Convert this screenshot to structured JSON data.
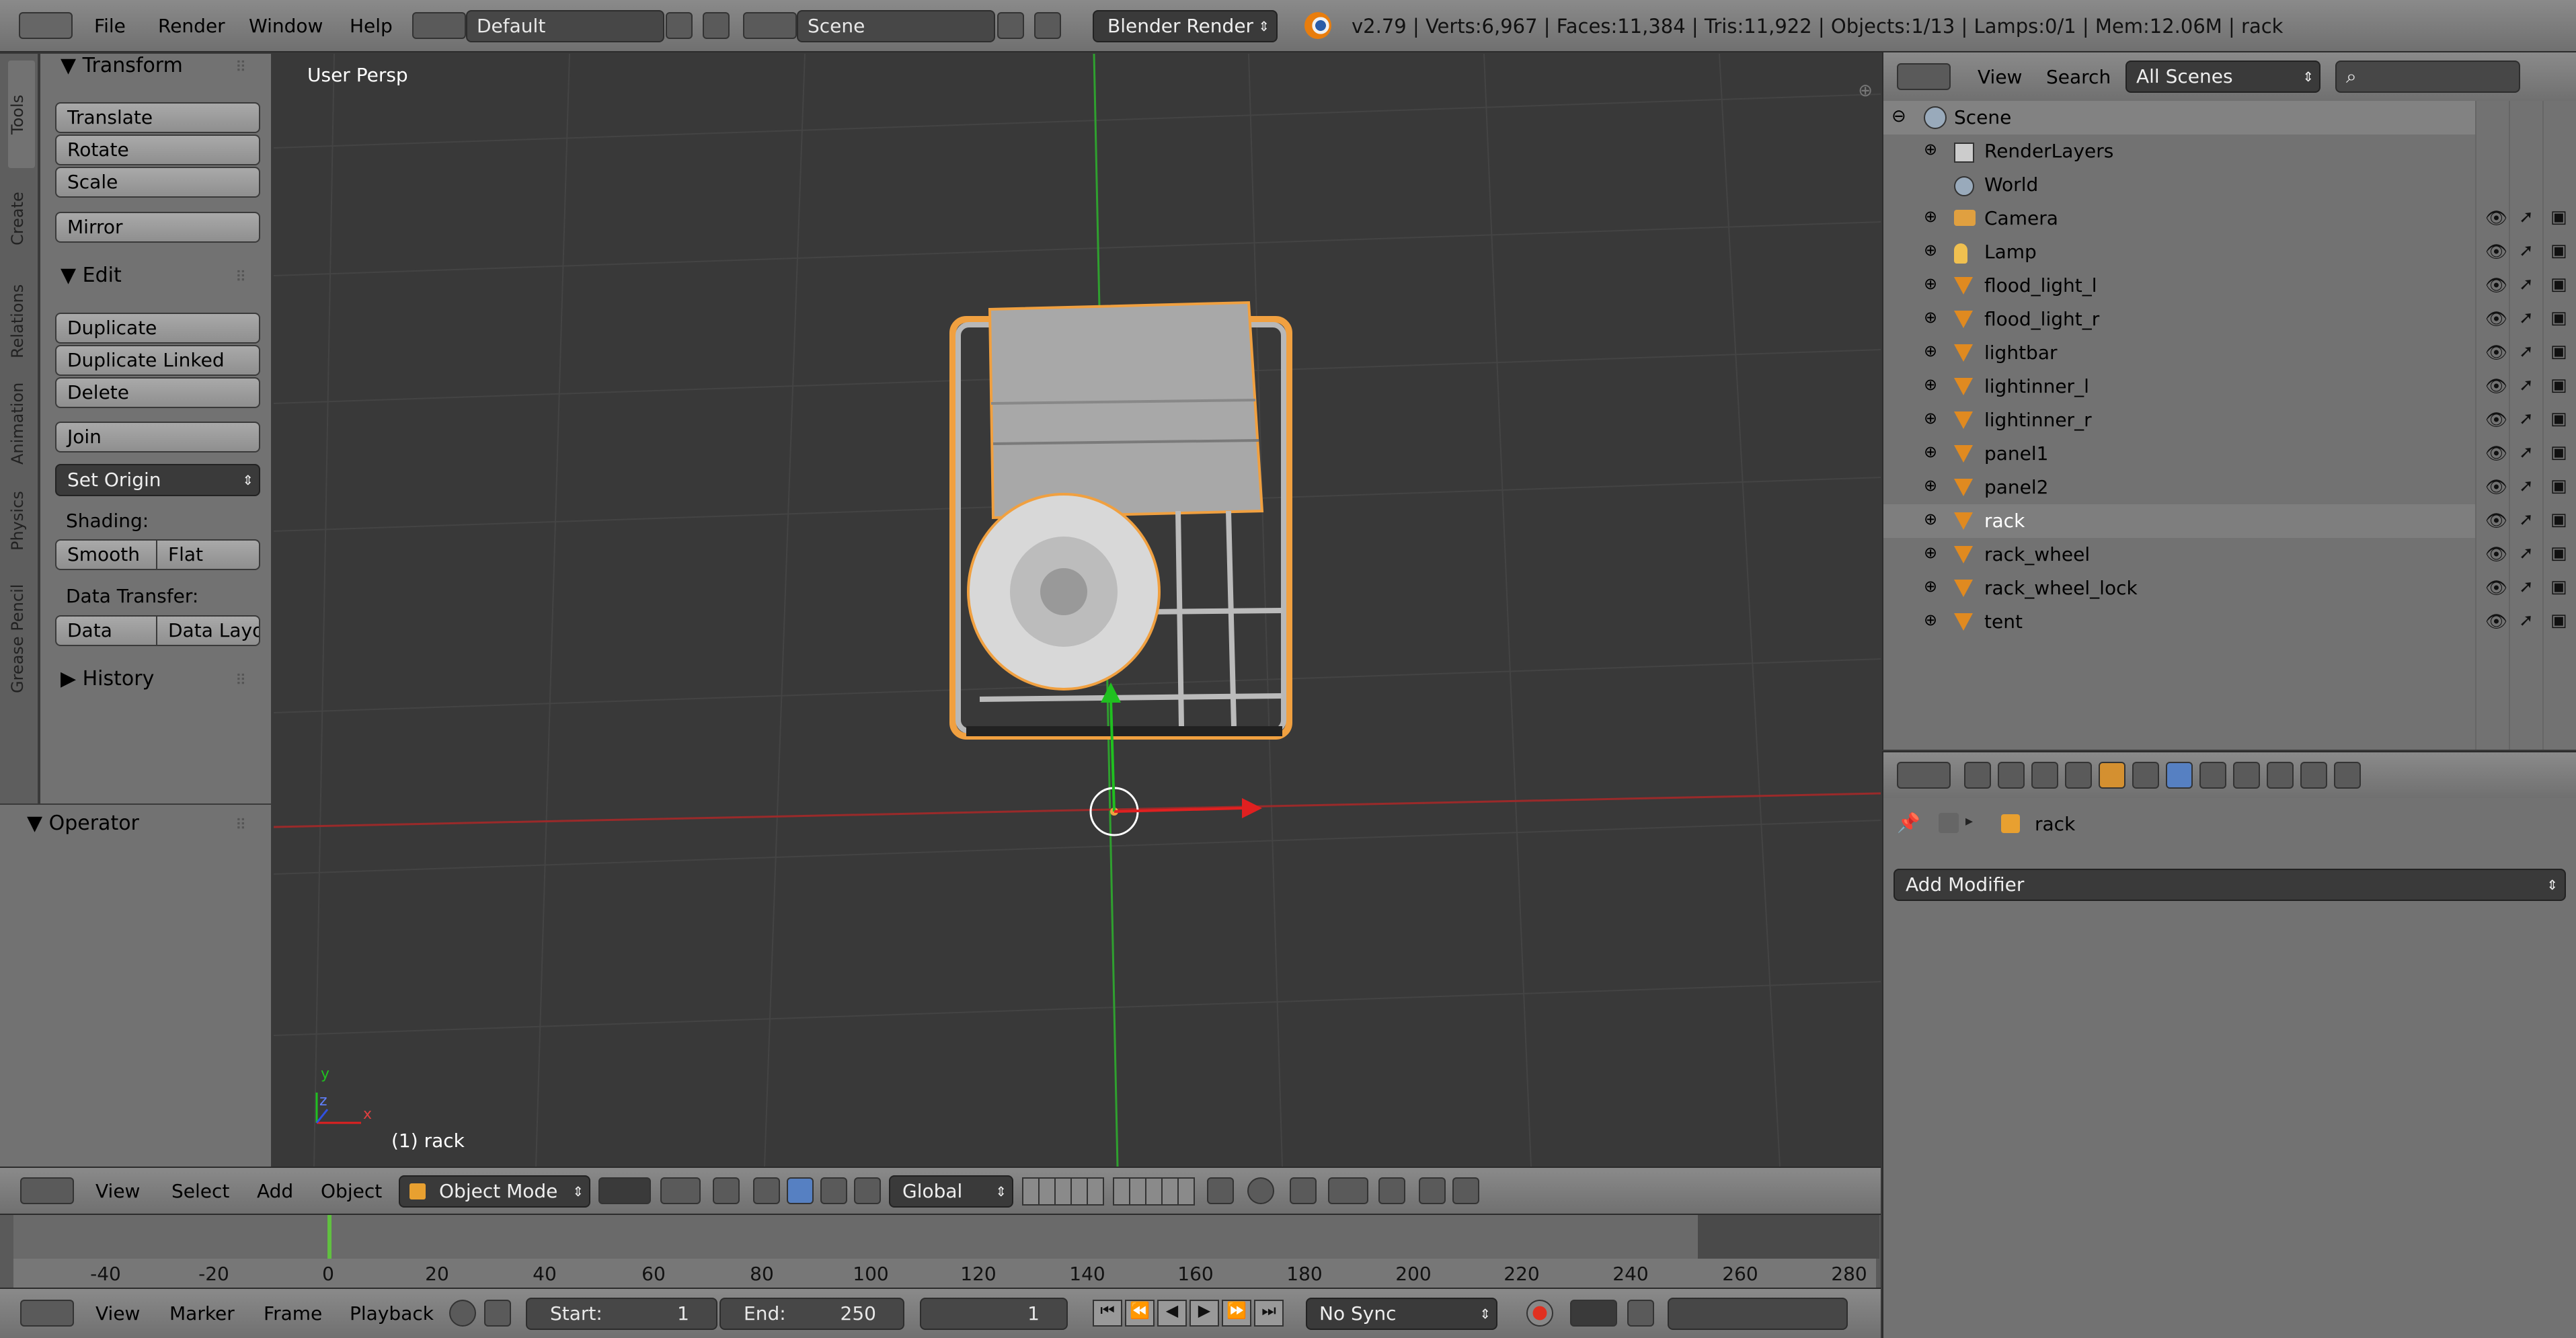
{
  "topbar": {
    "menus": [
      "File",
      "Render",
      "Window",
      "Help"
    ],
    "screen_layout": "Default",
    "scene": "Scene",
    "render_engine": "Blender Render",
    "stats": "v2.79 | Verts:6,967 | Faces:11,384 | Tris:11,922 | Objects:1/13 | Lamps:0/1 | Mem:12.06M | rack"
  },
  "tool_shelf": {
    "tabs": [
      "Tools",
      "Create",
      "Relations",
      "Animation",
      "Physics",
      "Grease Pencil"
    ],
    "transform_title": "Transform",
    "translate": "Translate",
    "rotate": "Rotate",
    "scale": "Scale",
    "mirror": "Mirror",
    "edit_title": "Edit",
    "duplicate": "Duplicate",
    "duplicate_linked": "Duplicate Linked",
    "delete": "Delete",
    "join": "Join",
    "set_origin": "Set Origin",
    "shading_label": "Shading:",
    "smooth": "Smooth",
    "flat": "Flat",
    "data_transfer_label": "Data Transfer:",
    "data": "Data",
    "data_layout": "Data Layo",
    "history_title": "History",
    "operator_title": "Operator"
  },
  "viewport": {
    "view_label": "User Persp",
    "object_label": "(1) rack",
    "axis_y": "y",
    "axis_z": "z",
    "axis_x": "x"
  },
  "viewport_header": {
    "menus": [
      "View",
      "Select",
      "Add",
      "Object"
    ],
    "mode": "Object Mode",
    "orientation": "Global"
  },
  "outliner": {
    "menus": [
      "View",
      "Search"
    ],
    "display_mode": "All Scenes",
    "scene": "Scene",
    "items": [
      {
        "name": "RenderLayers",
        "icon": "render-layers-icon",
        "visibility": false
      },
      {
        "name": "World",
        "icon": "world-icon",
        "visibility": false
      },
      {
        "name": "Camera",
        "icon": "camera-icon",
        "visibility": true
      },
      {
        "name": "Lamp",
        "icon": "lamp-icon",
        "visibility": true
      },
      {
        "name": "flood_light_l",
        "icon": "mesh-icon",
        "visibility": true
      },
      {
        "name": "flood_light_r",
        "icon": "mesh-icon",
        "visibility": true
      },
      {
        "name": "lightbar",
        "icon": "mesh-icon",
        "visibility": true
      },
      {
        "name": "lightinner_l",
        "icon": "mesh-icon",
        "visibility": true
      },
      {
        "name": "lightinner_r",
        "icon": "mesh-icon",
        "visibility": true
      },
      {
        "name": "panel1",
        "icon": "mesh-icon",
        "visibility": true
      },
      {
        "name": "panel2",
        "icon": "mesh-icon",
        "visibility": true
      },
      {
        "name": "rack",
        "icon": "mesh-icon",
        "visibility": true
      },
      {
        "name": "rack_wheel",
        "icon": "mesh-icon",
        "visibility": true
      },
      {
        "name": "rack_wheel_lock",
        "icon": "mesh-icon",
        "visibility": true
      },
      {
        "name": "tent",
        "icon": "mesh-icon",
        "visibility": true
      }
    ]
  },
  "properties": {
    "object_name": "rack",
    "add_modifier": "Add Modifier"
  },
  "timeline": {
    "ticks": [
      "-40",
      "-20",
      "0",
      "20",
      "40",
      "60",
      "80",
      "100",
      "120",
      "140",
      "160",
      "180",
      "200",
      "220",
      "240",
      "260",
      "280"
    ],
    "menus": [
      "View",
      "Marker",
      "Frame",
      "Playback"
    ],
    "start_label": "Start:",
    "start_value": "1",
    "end_label": "End:",
    "end_value": "250",
    "current_frame": "1",
    "sync": "No Sync"
  },
  "colors": {
    "viewport_bg": "#393939",
    "panel_bg": "#727272",
    "selection_orange": "#f0a040",
    "x_axis": "#d02020",
    "y_axis": "#20c020",
    "active_blue": "#5680c2"
  }
}
